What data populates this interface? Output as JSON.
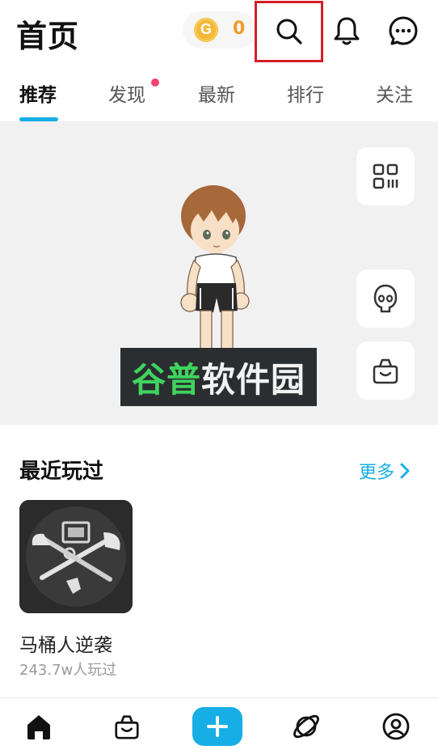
{
  "header": {
    "title": "首页",
    "coin_symbol": "G",
    "coin_count": "0"
  },
  "tabs": [
    {
      "label": "推荐",
      "active": true
    },
    {
      "label": "发现",
      "has_dot": true
    },
    {
      "label": "最新"
    },
    {
      "label": "排行"
    },
    {
      "label": "关注"
    }
  ],
  "hero": {
    "watermark_green": "谷普",
    "watermark_white": "软件园"
  },
  "recent": {
    "title": "最近玩过",
    "more_label": "更多",
    "game": {
      "name": "马桶人逆袭",
      "plays": "243.7w人玩过"
    }
  },
  "icons": {
    "search": "search-icon",
    "bell": "bell-icon",
    "message": "chat-bubble-icon",
    "qr": "qr-code-icon",
    "avatar_side": "ghost-avatar-icon",
    "shop_side": "shopping-bag-icon",
    "nav_home": "home-icon",
    "nav_shop": "shopping-bag-icon",
    "nav_add": "plus-icon",
    "nav_planet": "planet-icon",
    "nav_profile": "user-icon"
  },
  "colors": {
    "accent": "#17aee6",
    "coin": "#f3b83a",
    "coin_text": "#f39a2b",
    "badge_dot": "#f4436c",
    "highlight_box": "#d31e25"
  }
}
